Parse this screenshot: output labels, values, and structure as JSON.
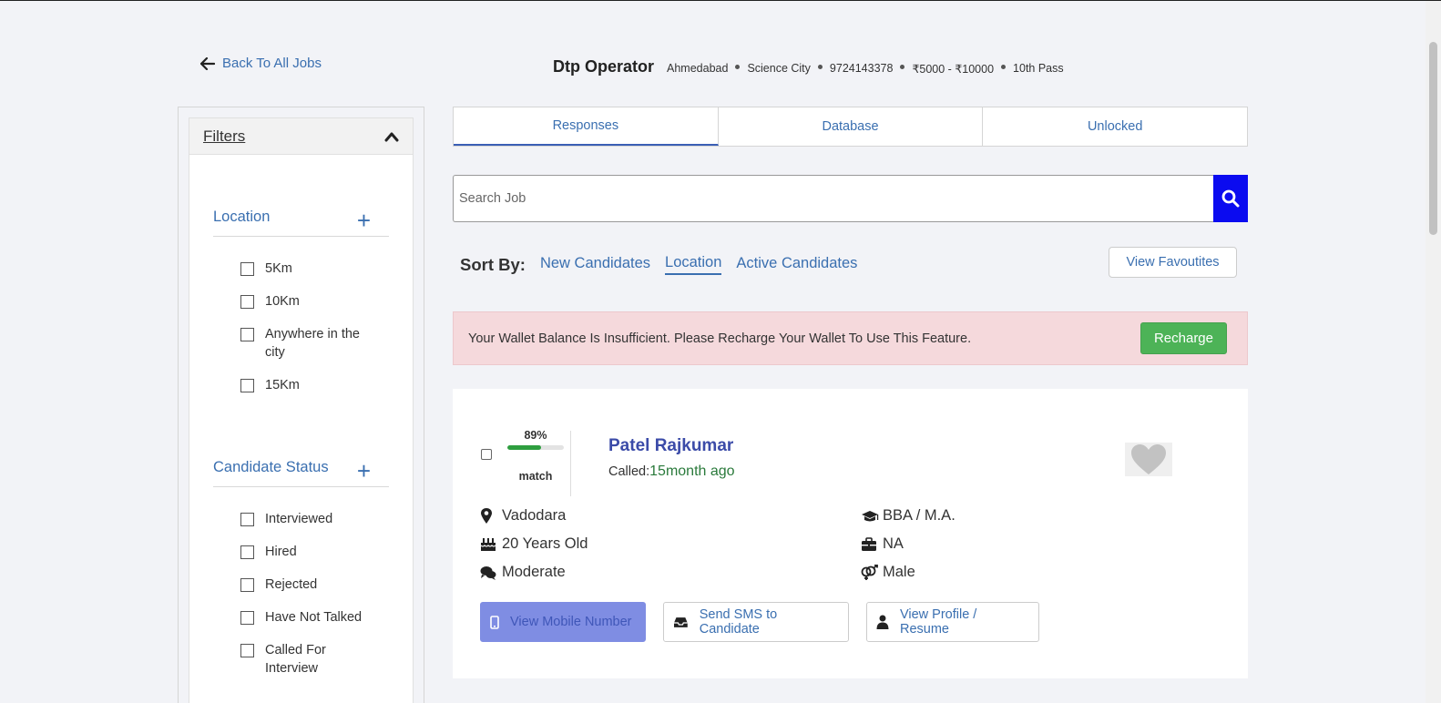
{
  "back_link": "Back To All Jobs",
  "job": {
    "title": "Dtp Operator",
    "meta": [
      "Ahmedabad",
      "Science City",
      "9724143378",
      "₹5000 - ₹10000",
      "10th Pass"
    ]
  },
  "filters": {
    "heading": "Filters",
    "location": {
      "title": "Location",
      "options": [
        "5Km",
        "10Km",
        "Anywhere in the city",
        "15Km"
      ]
    },
    "candidate_status": {
      "title": "Candidate Status",
      "options": [
        "Interviewed",
        "Hired",
        "Rejected",
        "Have Not Talked",
        "Called For Interview"
      ]
    }
  },
  "tabs": [
    {
      "label": "Responses",
      "active": true
    },
    {
      "label": "Database",
      "active": false
    },
    {
      "label": "Unlocked",
      "active": false
    }
  ],
  "search": {
    "placeholder": "Search Job",
    "value": ""
  },
  "sort": {
    "label": "Sort By:",
    "options": [
      "New Candidates",
      "Location",
      "Active Candidates"
    ],
    "active": "Location"
  },
  "view_favourites_label": "View Favoutites",
  "alert": {
    "message": "Your Wallet Balance Is Insufficient. Please Recharge Your Wallet To Use This Feature.",
    "button": "Recharge"
  },
  "candidate": {
    "match_percent_label": "89%",
    "match_fraction": 0.6,
    "match_word": "match",
    "name": "Patel Rajkumar",
    "called_label": "Called:",
    "called_ago": "15month ago",
    "location": "Vadodara",
    "age": "20 Years Old",
    "english": "Moderate",
    "education": "BBA / M.A.",
    "experience": "NA",
    "gender": "Male",
    "actions": {
      "view_mobile": "View Mobile Number",
      "send_sms": "Send SMS to Candidate",
      "view_profile": "View Profile / Resume"
    }
  },
  "colors": {
    "link": "#3a6fb0",
    "search_button": "#0b0bf0",
    "alert_bg": "#f5d9dc",
    "recharge_bg": "#4db357",
    "name": "#3b4ba8",
    "match_fill": "#2e9e3f",
    "disabled_button": "#7f8de3"
  },
  "icons": [
    "arrow-left-icon",
    "chevron-up-icon",
    "plus-icon",
    "search-icon",
    "heart-icon",
    "map-pin-icon",
    "birthday-cake-icon",
    "comments-icon",
    "graduation-cap-icon",
    "briefcase-icon",
    "gender-icon",
    "mobile-icon",
    "inbox-icon",
    "user-icon"
  ]
}
